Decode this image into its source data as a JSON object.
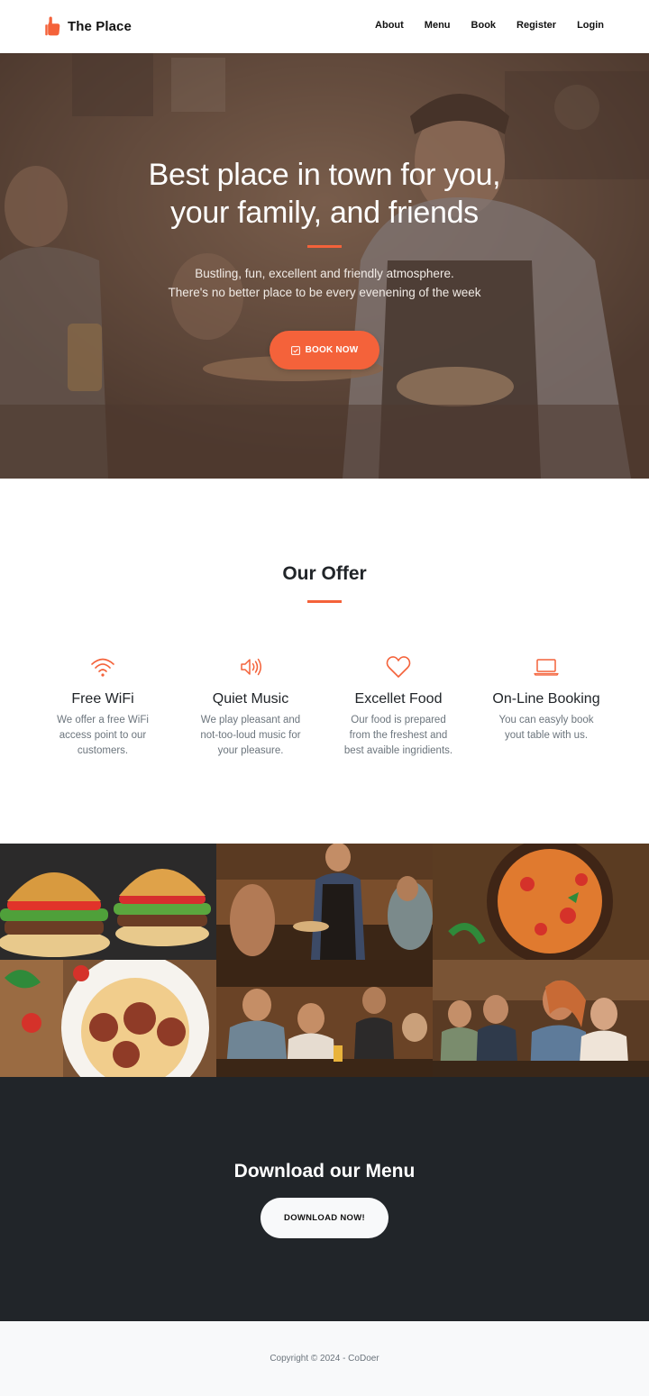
{
  "brand": {
    "name": "The Place",
    "icon": "thumbs-up-icon",
    "accent_color": "#f4623a"
  },
  "nav": {
    "items": [
      "About",
      "Menu",
      "Book",
      "Register",
      "Login"
    ]
  },
  "hero": {
    "title_line1": "Best place in town for you,",
    "title_line2": "your family, and friends",
    "subtitle_line1": "Bustling, fun, excellent and friendly atmosphere.",
    "subtitle_line2": "There's no better place to be every evenening of the week",
    "button_label": "BOOK NOW",
    "button_icon": "calendar-check-icon"
  },
  "offer": {
    "title": "Our Offer",
    "items": [
      {
        "icon": "wifi-icon",
        "title": "Free WiFi",
        "desc_lines": [
          "We offer a free WiFi",
          "access point to our",
          "customers."
        ]
      },
      {
        "icon": "volume-icon",
        "title": "Quiet Music",
        "desc_lines": [
          "We play pleasant and",
          "not-too-loud music for",
          "your pleasure."
        ]
      },
      {
        "icon": "heart-icon",
        "title": "Excellet Food",
        "desc_lines": [
          "Our food is prepared",
          "from the freshest and",
          "best avaible ingridients."
        ]
      },
      {
        "icon": "laptop-icon",
        "title": "On-Line Booking",
        "desc_lines": [
          "You can easyly book",
          "yout table with us."
        ]
      }
    ]
  },
  "gallery": {
    "tiles": [
      "burgers-photo",
      "waiter-serving-photo",
      "penne-pasta-photo",
      "pasta-meatballs-photo",
      "friends-dining-photo",
      "friends-at-bar-photo"
    ]
  },
  "download": {
    "title": "Download our Menu",
    "button_label": "DOWNLOAD NOW!"
  },
  "footer": {
    "copyright": "Copyright © 2024 - CoDoer"
  }
}
